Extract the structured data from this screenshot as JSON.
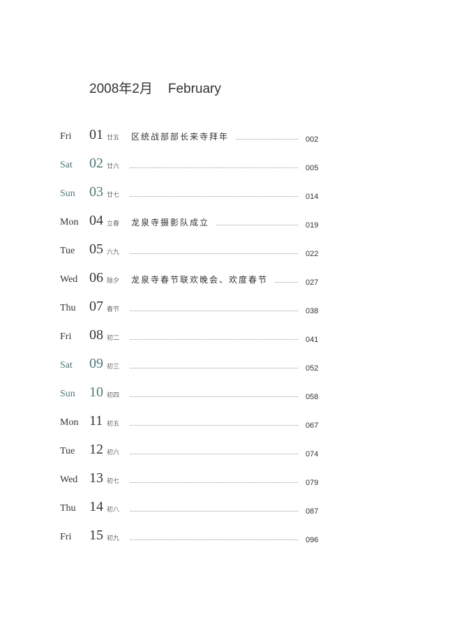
{
  "header": {
    "title_cn": "2008年2月",
    "title_en": "February"
  },
  "rows": [
    {
      "day": "Fri",
      "date": "01",
      "lunar": "廿五",
      "event": "区统战部部长来寺拜年",
      "page": "002",
      "weekend": false
    },
    {
      "day": "Sat",
      "date": "02",
      "lunar": "廿六",
      "event": "",
      "page": "005",
      "weekend": true
    },
    {
      "day": "Sun",
      "date": "03",
      "lunar": "廿七",
      "event": "",
      "page": "014",
      "weekend": true
    },
    {
      "day": "Mon",
      "date": "04",
      "lunar": "立春",
      "event": "龙泉寺摄影队成立",
      "page": "019",
      "weekend": false
    },
    {
      "day": "Tue",
      "date": "05",
      "lunar": "六九",
      "event": "",
      "page": "022",
      "weekend": false
    },
    {
      "day": "Wed",
      "date": "06",
      "lunar": "除夕",
      "event": "龙泉寺春节联欢晚会、欢度春节",
      "page": "027",
      "weekend": false
    },
    {
      "day": "Thu",
      "date": "07",
      "lunar": "春节",
      "event": "",
      "page": "038",
      "weekend": false
    },
    {
      "day": "Fri",
      "date": "08",
      "lunar": "初二",
      "event": "",
      "page": "041",
      "weekend": false
    },
    {
      "day": "Sat",
      "date": "09",
      "lunar": "初三",
      "event": "",
      "page": "052",
      "weekend": true
    },
    {
      "day": "Sun",
      "date": "10",
      "lunar": "初四",
      "event": "",
      "page": "058",
      "weekend": true
    },
    {
      "day": "Mon",
      "date": "11",
      "lunar": "初五",
      "event": "",
      "page": "067",
      "weekend": false
    },
    {
      "day": "Tue",
      "date": "12",
      "lunar": "初六",
      "event": "",
      "page": "074",
      "weekend": false
    },
    {
      "day": "Wed",
      "date": "13",
      "lunar": "初七",
      "event": "",
      "page": "079",
      "weekend": false
    },
    {
      "day": "Thu",
      "date": "14",
      "lunar": "初八",
      "event": "",
      "page": "087",
      "weekend": false
    },
    {
      "day": "Fri",
      "date": "15",
      "lunar": "初九",
      "event": "",
      "page": "096",
      "weekend": false
    }
  ],
  "colors": {
    "text": "#333333",
    "weekend": "#4e7878",
    "leader": "#9a9a9a"
  }
}
